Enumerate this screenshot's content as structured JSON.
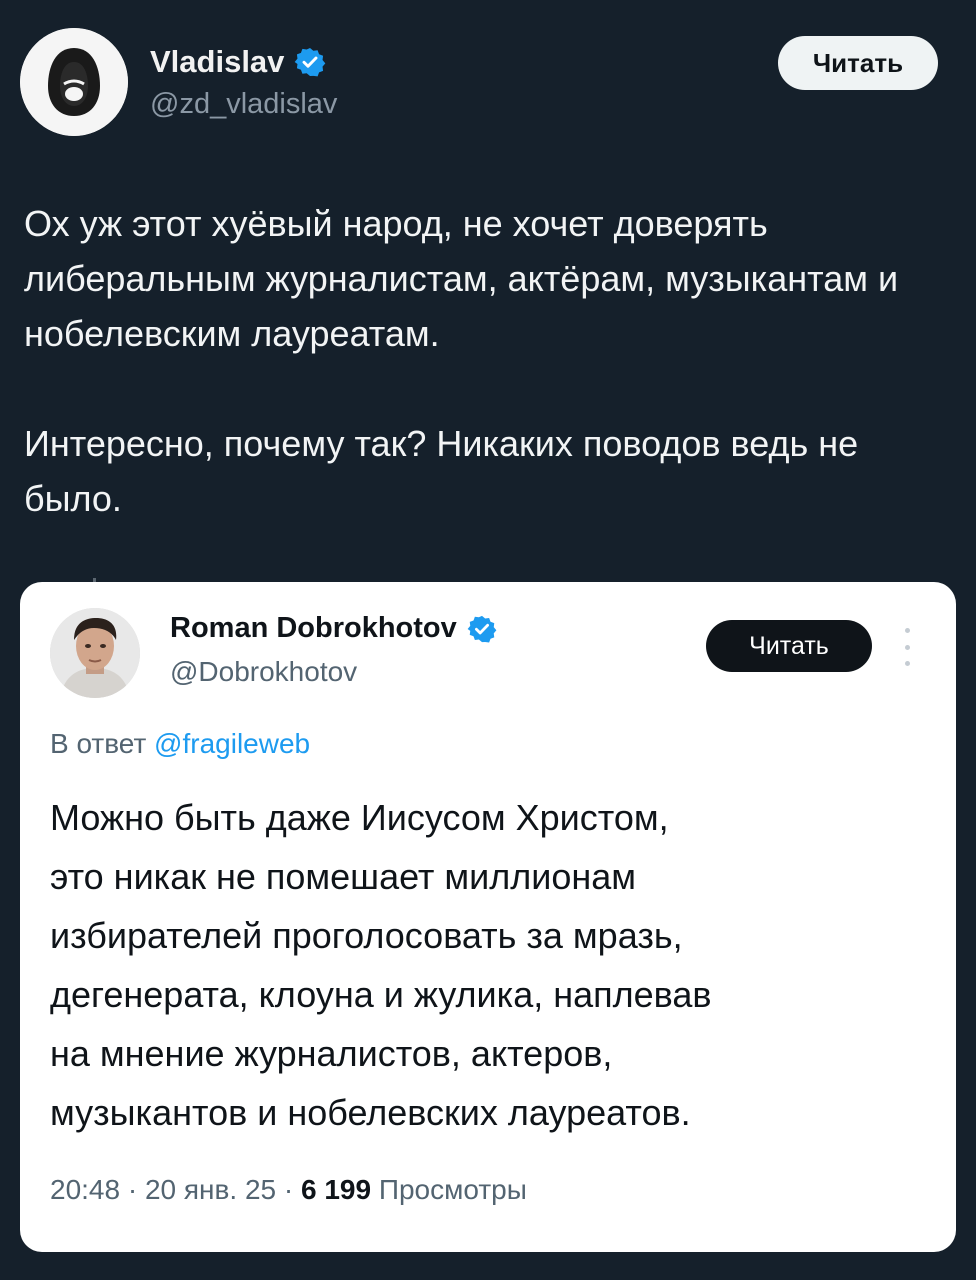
{
  "outer_tweet": {
    "display_name": "Vladislav",
    "handle": "@zd_vladislav",
    "follow_label": "Читать",
    "text_paragraphs": [
      "Ох уж этот хуёвый народ, не хочет доверять либеральным журналистам, актёрам, музыкантам и нобелевским лауреатам.",
      "Интересно, почему так? Никаких поводов ведь не было."
    ]
  },
  "quoted_tweet": {
    "display_name": "Roman Dobrokhotov",
    "handle": "@Dobrokhotov",
    "follow_label": "Читать",
    "reply_prefix": "В ответ",
    "reply_handle": "@fragileweb",
    "text_lines": [
      "Можно быть даже Иисусом Христом,",
      "это никак не помешает миллионам",
      "избирателей проголосовать за  мразь,",
      "дегенерата, клоуна и жулика, наплевав",
      "на мнение журналистов, актеров,",
      "музыкантов и нобелевских лауреатов."
    ],
    "time": "20:48",
    "date": "20 янв. 25",
    "views_count": "6 199",
    "views_label": "Просмотры"
  },
  "colors": {
    "background": "#15202b",
    "verified_badge": "#1d9bf0",
    "link": "#1d9bf0"
  },
  "icons": [
    "hacker-avatar-icon",
    "verified-badge-icon",
    "more-options-icon"
  ]
}
